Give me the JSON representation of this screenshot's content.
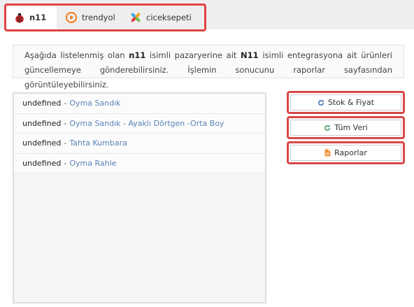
{
  "tabs": [
    {
      "label": "n11",
      "icon": "ladybug-icon",
      "active": true
    },
    {
      "label": "trendyol",
      "icon": "trendyol-play-icon",
      "active": false
    },
    {
      "label": "ciceksepeti",
      "icon": "pinwheel-icon",
      "active": false
    }
  ],
  "info": {
    "part1": "Aşağıda listelenmiş olan ",
    "marketplace": "n11",
    "part2": " isimli pazaryerine ait ",
    "integration": "N11",
    "part3": " isimli entegrasyona ait ürünleri güncellemeye gönderebilirsiniz. İşlemin sonucunu raporlar sayfasından görüntüleyebilirsiniz."
  },
  "products": [
    {
      "id": "undefined",
      "sep": "-",
      "name": "Oyma Sandık"
    },
    {
      "id": "undefined",
      "sep": "-",
      "name": "Oyma Sandık - Ayaklı Dörtgen -Orta Boy"
    },
    {
      "id": "undefined",
      "sep": "-",
      "name": "Tahta Kumbara"
    },
    {
      "id": "undefined",
      "sep": "-",
      "name": "Oyma Rahle"
    }
  ],
  "buttons": {
    "stock": {
      "label": "Stok & Fiyat",
      "icon": "refresh-icon"
    },
    "all": {
      "label": "Tüm Veri",
      "icon": "refresh-icon"
    },
    "reports": {
      "label": "Raporlar",
      "icon": "file-icon"
    }
  },
  "colors": {
    "accent_outline": "#e04343",
    "link": "#5a84b8",
    "refresh_blue": "#3b6fb6",
    "refresh_green": "#3a9a5b",
    "file_orange": "#f0913a"
  }
}
